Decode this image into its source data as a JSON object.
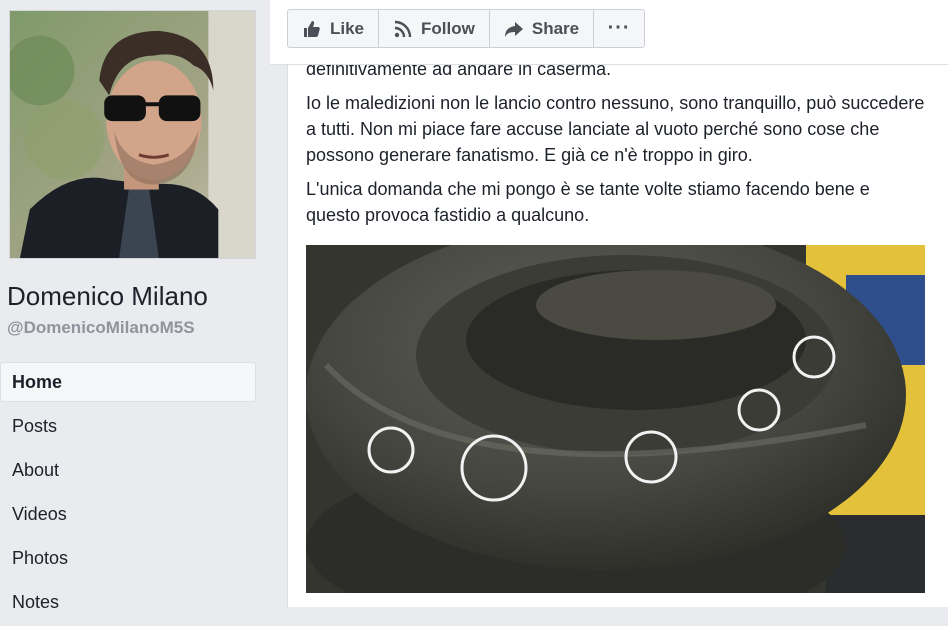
{
  "sidebar": {
    "page_name": "Domenico Milano",
    "page_handle": "@DomenicoMilanoM5S",
    "nav": [
      {
        "label": "Home",
        "active": true
      },
      {
        "label": "Posts"
      },
      {
        "label": "About"
      },
      {
        "label": "Videos"
      },
      {
        "label": "Photos"
      },
      {
        "label": "Notes"
      }
    ]
  },
  "action_bar": {
    "like_label": "Like",
    "follow_label": "Follow",
    "share_label": "Share",
    "more_label": "···"
  },
  "post": {
    "paragraphs": [
      "definitivamente ad andare in caserma.",
      "Io le maledizioni non le lancio contro nessuno, sono tranquillo, può succedere a tutti. Non mi piace fare accuse lanciate al vuoto perché sono cose che possono generare fanatismo. E già ce n'è troppo in giro.",
      "L'unica domanda che mi pongo è se tante volte stiamo facendo bene e questo provoca fastidio a qualcuno."
    ]
  },
  "colors": {
    "background": "#e9ebee",
    "card": "#ffffff",
    "text": "#1d2129",
    "muted": "#90949c",
    "button_text": "#4b4f56"
  }
}
